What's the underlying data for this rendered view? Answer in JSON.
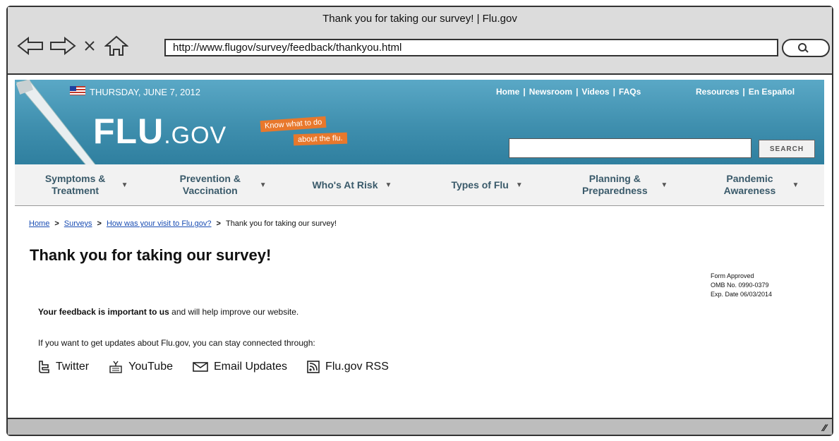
{
  "window": {
    "title": "Thank you for taking our survey! | Flu.gov"
  },
  "browser": {
    "url": "http://www.flugov/survey/feedback/thankyou.html",
    "nav_icons": [
      "back-arrow-icon",
      "forward-arrow-icon",
      "close-icon",
      "home-icon",
      "search-icon"
    ]
  },
  "header": {
    "date": "THURSDAY, JUNE 7, 2012",
    "top_links": [
      "Home",
      "Newsroom",
      "Videos",
      "FAQs"
    ],
    "resource_links": [
      "Resources",
      "En Español"
    ],
    "logo_main": "FLU",
    "logo_suffix": ".GOV",
    "tagline_1": "Know what to do",
    "tagline_2": "about the flu.",
    "search_button": "SEARCH",
    "search_value": ""
  },
  "mainnav": [
    {
      "label": "Symptoms & Treatment"
    },
    {
      "label": "Prevention & Vaccination"
    },
    {
      "label": "Who's At Risk"
    },
    {
      "label": "Types of Flu"
    },
    {
      "label": "Planning & Preparedness"
    },
    {
      "label": "Pandemic Awareness"
    }
  ],
  "breadcrumb": {
    "items": [
      "Home",
      "Surveys",
      "How was your visit to Flu.gov?"
    ],
    "current": "Thank you for taking our survey!"
  },
  "content": {
    "heading": "Thank you for taking our survey!",
    "omb_line1": "Form Approved",
    "omb_line2": "OMB No. 0990-0379",
    "omb_line3": "Exp. Date 06/03/2014",
    "feedback_bold": "Your feedback is important to us",
    "feedback_rest": " and will help improve our website.",
    "updates_text": "If you want to get updates about Flu.gov, you can stay connected through:",
    "social": [
      {
        "label": "Twitter",
        "icon": "twitter-icon"
      },
      {
        "label": "YouTube",
        "icon": "youtube-icon"
      },
      {
        "label": "Email Updates",
        "icon": "email-icon"
      },
      {
        "label": "Flu.gov RSS",
        "icon": "rss-icon"
      }
    ]
  },
  "colors": {
    "hero": "#3f8fae",
    "accent": "#e8782c",
    "link": "#1a4db3",
    "flag_blue": "#1f3f9f",
    "flag_red": "#c0392b"
  }
}
